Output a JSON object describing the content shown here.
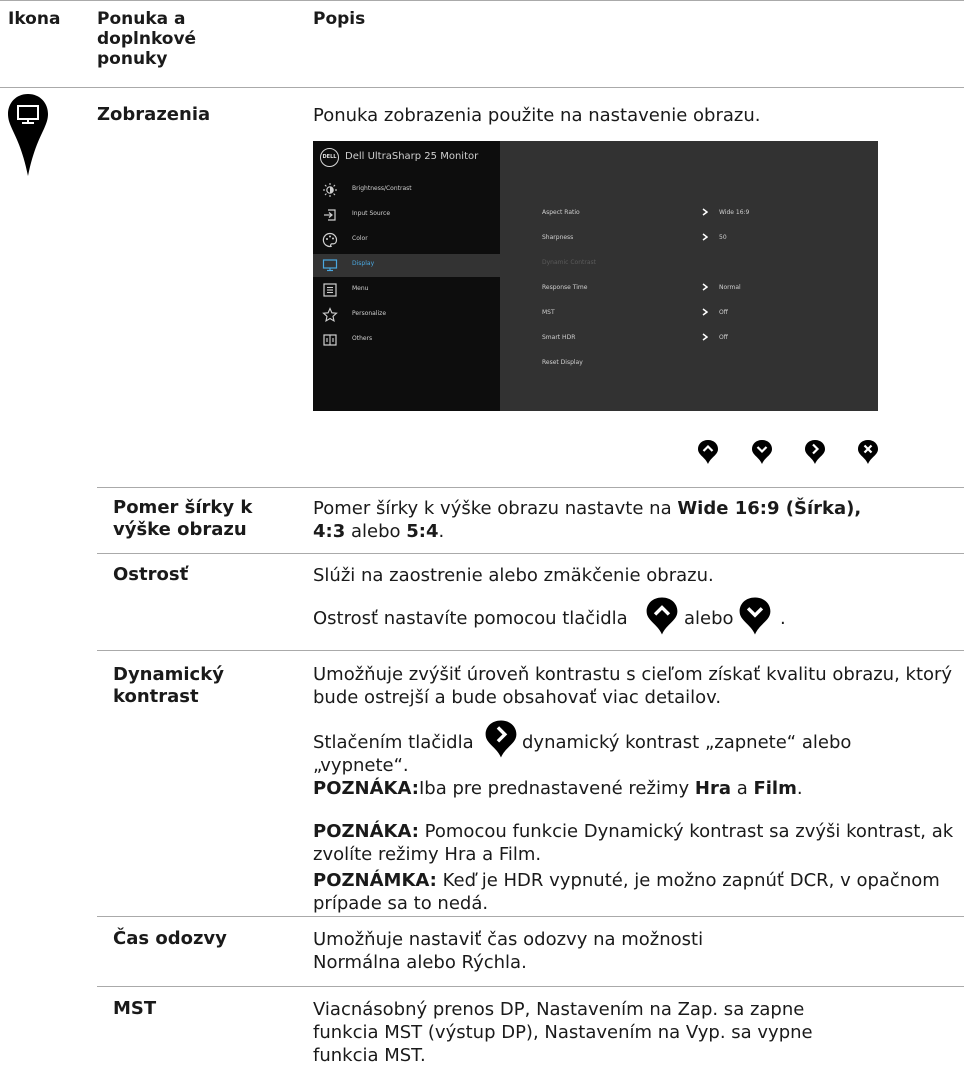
{
  "header": {
    "col_icon": "Ikona",
    "col_menu": "Ponuka a doplnkové ponuky",
    "col_desc": "Popis"
  },
  "display_section": {
    "icon": "monitor-icon",
    "menu_name": "Zobrazenia",
    "description": "Ponuka zobrazenia použite na nastavenie obrazu."
  },
  "osd": {
    "logo": "DELL",
    "title": "Dell UltraSharp 25 Monitor",
    "menu_items": [
      {
        "label": "Brightness/Contrast",
        "icon": "brightness-icon"
      },
      {
        "label": "Input Source",
        "icon": "input-source-icon"
      },
      {
        "label": "Color",
        "icon": "color-palette-icon"
      },
      {
        "label": "Display",
        "icon": "display-monitor-icon"
      },
      {
        "label": "Menu",
        "icon": "menu-list-icon"
      },
      {
        "label": "Personalize",
        "icon": "star-icon"
      },
      {
        "label": "Others",
        "icon": "others-icon"
      }
    ],
    "selected_item": "Display",
    "options": [
      {
        "label": "Aspect Ratio",
        "value": "Wide 16:9"
      },
      {
        "label": "Sharpness",
        "value": "50"
      },
      {
        "label": "Dynamic Contrast",
        "value": ""
      },
      {
        "label": "Response Time",
        "value": "Normal"
      },
      {
        "label": "MST",
        "value": "Off"
      },
      {
        "label": "Smart HDR",
        "value": "Off"
      },
      {
        "label": "Reset Display",
        "value": ""
      }
    ],
    "nav_buttons": [
      "up-button-icon",
      "down-button-icon",
      "right-button-icon",
      "close-button-icon"
    ]
  },
  "rows": {
    "aspect": {
      "term": "Pomer šírky k výške obrazu",
      "d1": "Pomer šírky k výške obrazu nastavte na ",
      "d2": "Wide 16:9 (Šírka),",
      "d3": "4:3",
      "d4": " alebo ",
      "d5": "5:4",
      "d6": "."
    },
    "sharpness": {
      "term": "Ostrosť",
      "line1": "Slúži na zaostrenie alebo zmäkčenie obrazu.",
      "line2a": "Ostrosť nastavíte pomocou tlačidla",
      "line2b": "alebo",
      "line2c": "."
    },
    "dynamic": {
      "term": "Dynamický kontrast",
      "p1": "Umožňuje zvýšiť úroveň kontrastu s cieľom získať kvalitu obrazu, ktorý bude ostrejší a bude obsahovať viac detailov.",
      "p2a": "Stlačením tlačidla",
      "p2b": "dynamický kontrast „zapnete“ alebo",
      "p2c": "„vypnete“.",
      "note1_label": "POZNÁKA:",
      "note1_a": "Iba pre prednastavené režimy ",
      "note1_b": "Hra",
      "note1_c": " a ",
      "note1_d": "Film",
      "note1_e": ".",
      "note2_label": "POZNÁKA:",
      "note2_text": " Pomocou funkcie Dynamický kontrast sa zvýši kontrast, ak zvolíte režimy Hra a Film.",
      "note3_label": "POZNÁMKA:",
      "note3_text": " Keď je HDR vypnuté, je možno zapnúť DCR, v opačnom prípade sa to nedá."
    },
    "response": {
      "term": "Čas odozvy",
      "desc": "Umožňuje nastaviť čas odozvy na možnosti Normálna alebo Rýchla."
    },
    "mst": {
      "term": "MST",
      "desc": "Viacnásobný prenos DP, Nastavením na Zap. sa zapne funkcia MST (výstup DP), Nastavením na Vyp. sa vypne funkcia MST."
    }
  }
}
